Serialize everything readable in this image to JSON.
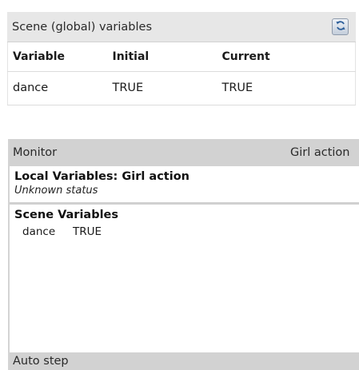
{
  "scene_panel": {
    "title": "Scene (global) variables",
    "refresh_icon": "refresh-icon",
    "columns": [
      "Variable",
      "Initial",
      "Current"
    ],
    "rows": [
      {
        "variable": "dance",
        "initial": "TRUE",
        "current": "TRUE"
      }
    ]
  },
  "monitor": {
    "title": "Monitor",
    "action_label": "Girl action",
    "local_title": "Local Variables: Girl action",
    "local_status": "Unknown status",
    "scene_title": "Scene Variables",
    "scene_vars": [
      {
        "name": "dance",
        "value": "TRUE"
      }
    ],
    "auto_step_label": "Auto step"
  }
}
